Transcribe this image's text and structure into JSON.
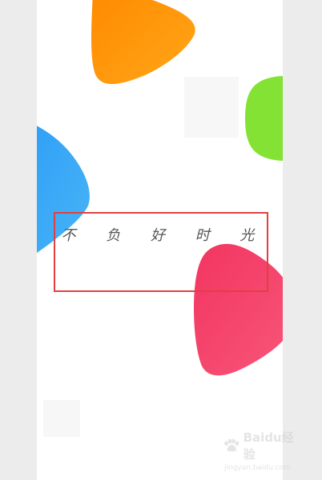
{
  "screen": {
    "slogan": "不 负 好 时 光"
  },
  "annotation": {
    "highlight_color": "#e24040"
  },
  "brand_shapes": {
    "orange": "#ff9500",
    "green": "#7de02a",
    "blue": "#3aa8f5",
    "pink": "#f4436c"
  },
  "watermark": {
    "brand": "Baidu经验",
    "url": "jingyan.baidu.com"
  }
}
